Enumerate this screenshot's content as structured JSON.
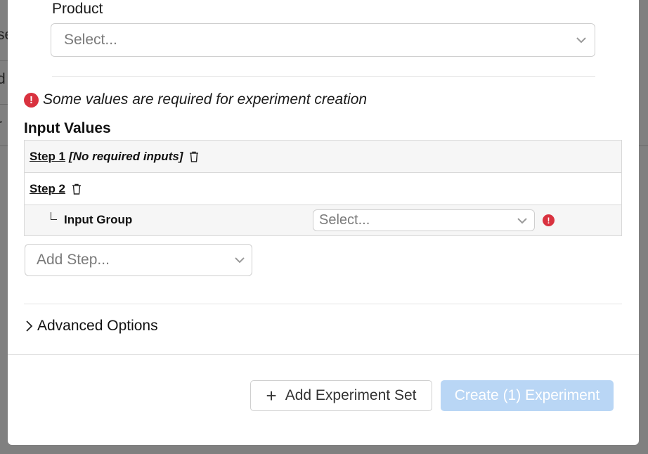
{
  "background": {
    "fragments": [
      "se",
      "d",
      "r"
    ]
  },
  "modal": {
    "product": {
      "label": "Product",
      "placeholder": "Select..."
    },
    "warning": {
      "icon": "exclamation-circle-icon",
      "text": "Some values are required for experiment creation",
      "color": "#d9323f"
    },
    "input_values": {
      "title": "Input Values",
      "steps": [
        {
          "label": "Step 1",
          "note": "[No required inputs]"
        },
        {
          "label": "Step 2",
          "note": ""
        }
      ],
      "input_group": {
        "label": "Input Group",
        "placeholder": "Select..."
      }
    },
    "add_step": {
      "placeholder": "Add Step..."
    },
    "advanced": {
      "label": "Advanced Options",
      "expanded": false
    },
    "footer": {
      "add_set_label": "Add Experiment Set",
      "create_label": "Create (1) Experiment",
      "create_disabled": true,
      "accent": "#b9d6f5"
    }
  }
}
